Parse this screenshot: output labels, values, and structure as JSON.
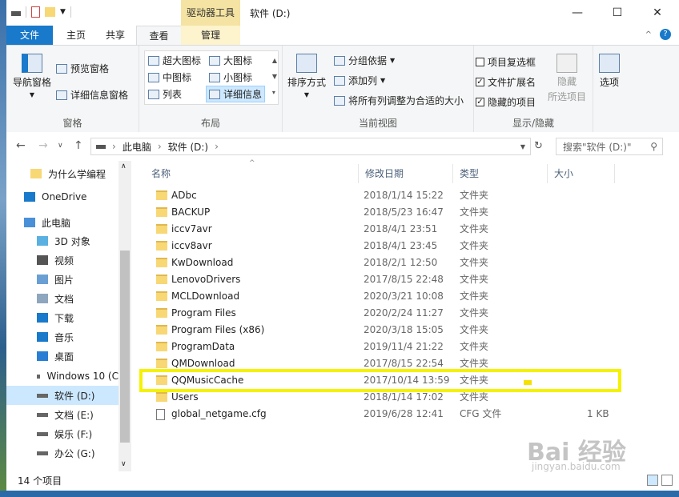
{
  "title_bar": {
    "contextual_tab": "驱动器工具",
    "window_title": "软件 (D:)",
    "minimize": "—",
    "maximize": "☐",
    "close": "✕"
  },
  "tabs": {
    "file": "文件",
    "home": "主页",
    "share": "共享",
    "view": "查看",
    "manage": "管理"
  },
  "ribbon": {
    "panes": {
      "nav_pane": "导航窗格",
      "preview": "预览窗格",
      "details": "详细信息窗格",
      "group": "窗格"
    },
    "layout": {
      "xl_icons": "超大图标",
      "large_icons": "大图标",
      "medium_icons": "中图标",
      "small_icons": "小图标",
      "list": "列表",
      "details": "详细信息",
      "group": "布局"
    },
    "current_view": {
      "sort_by": "排序方式",
      "group_by": "分组依据",
      "add_columns": "添加列",
      "size_all_columns": "将所有列调整为合适的大小",
      "group": "当前视图"
    },
    "show_hide": {
      "item_checkboxes": "项目复选框",
      "item_checkboxes_checked": false,
      "file_extensions": "文件扩展名",
      "file_extensions_checked": true,
      "hidden_items": "隐藏的项目",
      "hidden_items_checked": true,
      "hide_selected": "隐藏",
      "hide_selected_sub": "所选项目",
      "group": "显示/隐藏"
    },
    "options": "选项"
  },
  "address": {
    "crumbs": [
      "此电脑",
      "软件 (D:)"
    ],
    "search_placeholder": "搜索\"软件 (D:)\""
  },
  "nav_pane": {
    "items": [
      {
        "label": "为什么学编程",
        "icon": "folder-icon"
      },
      {
        "label": "OneDrive",
        "icon": "cloud-icon"
      },
      {
        "label": "此电脑",
        "icon": "computer-icon"
      },
      {
        "label": "3D 对象",
        "icon": "cube-icon"
      },
      {
        "label": "视频",
        "icon": "video-icon"
      },
      {
        "label": "图片",
        "icon": "picture-icon"
      },
      {
        "label": "文档",
        "icon": "document-icon"
      },
      {
        "label": "下载",
        "icon": "download-icon"
      },
      {
        "label": "音乐",
        "icon": "music-icon"
      },
      {
        "label": "桌面",
        "icon": "desktop-icon"
      },
      {
        "label": "Windows 10 (C",
        "icon": "drive-icon"
      },
      {
        "label": "软件 (D:)",
        "icon": "drive-icon"
      },
      {
        "label": "文档 (E:)",
        "icon": "drive-icon"
      },
      {
        "label": "娱乐 (F:)",
        "icon": "drive-icon"
      },
      {
        "label": "办公 (G:)",
        "icon": "drive-icon"
      }
    ]
  },
  "columns": {
    "name": "名称",
    "date": "修改日期",
    "type": "类型",
    "size": "大小"
  },
  "files": [
    {
      "name": "ADbc",
      "date": "2018/1/14 15:22",
      "type": "文件夹",
      "size": ""
    },
    {
      "name": "BACKUP",
      "date": "2018/5/23 16:47",
      "type": "文件夹",
      "size": ""
    },
    {
      "name": "iccv7avr",
      "date": "2018/4/1 23:51",
      "type": "文件夹",
      "size": ""
    },
    {
      "name": "iccv8avr",
      "date": "2018/4/1 23:45",
      "type": "文件夹",
      "size": ""
    },
    {
      "name": "KwDownload",
      "date": "2018/2/1 12:50",
      "type": "文件夹",
      "size": ""
    },
    {
      "name": "LenovoDrivers",
      "date": "2017/8/15 22:48",
      "type": "文件夹",
      "size": ""
    },
    {
      "name": "MCLDownload",
      "date": "2020/3/21 10:08",
      "type": "文件夹",
      "size": ""
    },
    {
      "name": "Program Files",
      "date": "2020/2/24 11:27",
      "type": "文件夹",
      "size": ""
    },
    {
      "name": "Program Files (x86)",
      "date": "2020/3/18 15:05",
      "type": "文件夹",
      "size": ""
    },
    {
      "name": "ProgramData",
      "date": "2019/11/4 21:22",
      "type": "文件夹",
      "size": ""
    },
    {
      "name": "QMDownload",
      "date": "2017/8/15 22:54",
      "type": "文件夹",
      "size": ""
    },
    {
      "name": "QQMusicCache",
      "date": "2017/10/14 13:59",
      "type": "文件夹",
      "size": ""
    },
    {
      "name": "Users",
      "date": "2018/1/14 17:02",
      "type": "文件夹",
      "size": ""
    },
    {
      "name": "global_netgame.cfg",
      "date": "2019/6/28 12:41",
      "type": "CFG 文件",
      "size": "1 KB"
    }
  ],
  "status": {
    "count": "14 个项目"
  },
  "watermark": {
    "main": "Bai 经验",
    "sub": "jingyan.baidu.com"
  }
}
